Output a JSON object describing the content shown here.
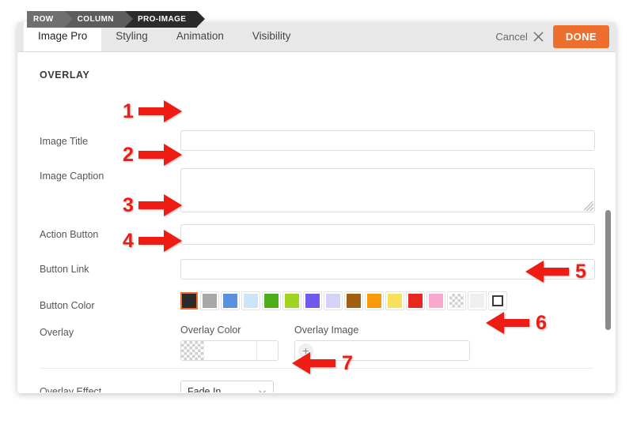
{
  "breadcrumb": {
    "name": "breadcrumb",
    "items": [
      {
        "label": "ROW"
      },
      {
        "label": "COLUMN"
      },
      {
        "label": "PRO-IMAGE"
      }
    ]
  },
  "tabs": [
    {
      "label": "Image Pro",
      "active": true
    },
    {
      "label": "Styling",
      "active": false
    },
    {
      "label": "Animation",
      "active": false
    },
    {
      "label": "Visibility",
      "active": false
    }
  ],
  "header": {
    "cancel_label": "Cancel",
    "cancel_icon": "close-icon",
    "done_label": "DONE",
    "done_color": "#ee6e2e"
  },
  "section": {
    "title": "OVERLAY"
  },
  "fields": {
    "image_title": {
      "label": "Image Title",
      "value": "",
      "placeholder": ""
    },
    "image_caption": {
      "label": "Image Caption",
      "value": "",
      "placeholder": ""
    },
    "action_button": {
      "label": "Action Button",
      "value": "",
      "placeholder": ""
    },
    "button_link": {
      "label": "Button Link",
      "value": "",
      "placeholder": ""
    },
    "button_color": {
      "label": "Button Color"
    },
    "overlay": {
      "label": "Overlay"
    },
    "overlay_color": {
      "label": "Overlay Color",
      "value": "",
      "swatch": "transparent"
    },
    "overlay_image": {
      "label": "Overlay Image",
      "add_icon": "plus-icon",
      "value": ""
    },
    "overlay_effect": {
      "label": "Overlay Effect",
      "value": "Fade In",
      "chevron": "chevron-down-icon"
    }
  },
  "button_color_swatches": [
    {
      "color": "#2b2b2b",
      "selected": true,
      "kind": "solid"
    },
    {
      "color": "#a8a8a8",
      "selected": false,
      "kind": "solid"
    },
    {
      "color": "#5b8fe0",
      "selected": false,
      "kind": "solid"
    },
    {
      "color": "#cee3f8",
      "selected": false,
      "kind": "solid"
    },
    {
      "color": "#4caf1a",
      "selected": false,
      "kind": "solid"
    },
    {
      "color": "#9fd420",
      "selected": false,
      "kind": "solid"
    },
    {
      "color": "#6e5bee",
      "selected": false,
      "kind": "solid"
    },
    {
      "color": "#d5d2f7",
      "selected": false,
      "kind": "solid"
    },
    {
      "color": "#a35f11",
      "selected": false,
      "kind": "solid"
    },
    {
      "color": "#f99a0b",
      "selected": false,
      "kind": "solid"
    },
    {
      "color": "#f7e05b",
      "selected": false,
      "kind": "solid"
    },
    {
      "color": "#e8281e",
      "selected": false,
      "kind": "solid"
    },
    {
      "color": "#fba8d1",
      "selected": false,
      "kind": "solid"
    },
    {
      "color": "transparent",
      "selected": false,
      "kind": "checker"
    },
    {
      "color": "#efefef",
      "selected": false,
      "kind": "solid"
    },
    {
      "color": "#ffffff",
      "selected": false,
      "kind": "outline"
    }
  ],
  "annotations": {
    "color": "#ee1c13",
    "items": [
      {
        "number": "1",
        "direction": "right"
      },
      {
        "number": "2",
        "direction": "right"
      },
      {
        "number": "3",
        "direction": "right"
      },
      {
        "number": "4",
        "direction": "right"
      },
      {
        "number": "5",
        "direction": "left"
      },
      {
        "number": "6",
        "direction": "left"
      },
      {
        "number": "7",
        "direction": "left"
      }
    ]
  }
}
